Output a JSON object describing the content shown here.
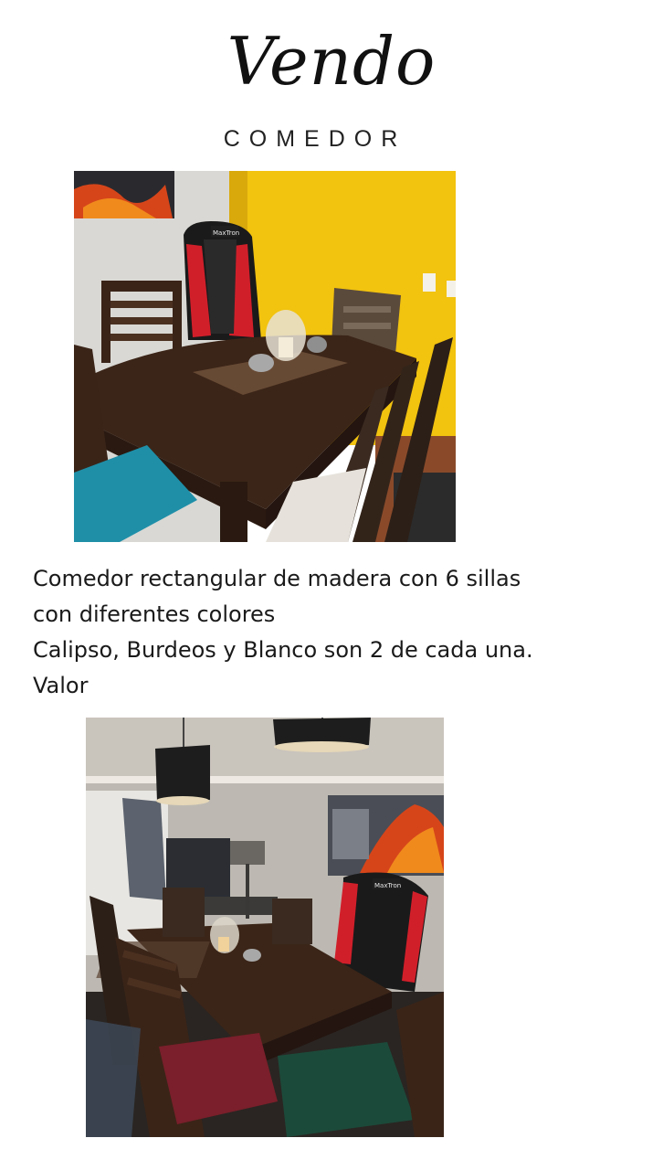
{
  "header": {
    "title": "Vendo",
    "subtitle": "COMEDOR"
  },
  "photos": [
    {
      "icon": "dining-table-photo",
      "chair_brand": "MaxTron"
    },
    {
      "icon": "dining-room-photo",
      "chair_brand": "MaxTron"
    }
  ],
  "description": {
    "lines": [
      "Comedor rectangular de madera con 6 sillas",
      "con diferentes colores",
      "Calipso, Burdeos y Blanco son 2 de cada una.",
      "Valor"
    ]
  },
  "colors": {
    "wall_yellow": "#f2c30f",
    "wood_dark": "#3b2518",
    "chair_teal": "#1f8fa8",
    "chair_burgundy": "#7a1f2b",
    "chair_green": "#1c4a3a",
    "gaming_chair_red": "#d11f2a"
  }
}
